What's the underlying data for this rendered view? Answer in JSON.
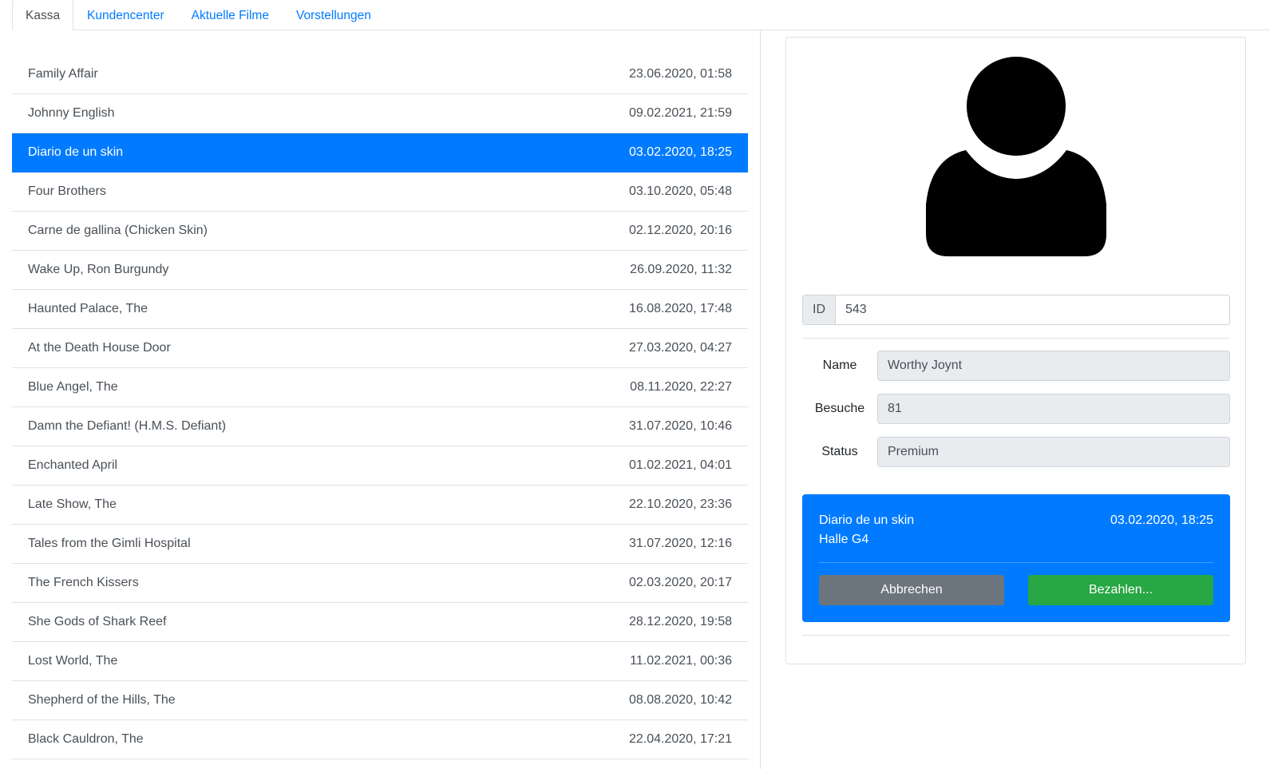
{
  "tabs": [
    {
      "label": "Kassa"
    },
    {
      "label": "Kundencenter"
    },
    {
      "label": "Aktuelle Filme"
    },
    {
      "label": "Vorstellungen"
    }
  ],
  "shows": [
    {
      "title": "Family Affair",
      "datetime": "23.06.2020, 01:58"
    },
    {
      "title": "Johnny English",
      "datetime": "09.02.2021, 21:59"
    },
    {
      "title": "Diario de un skin",
      "datetime": "03.02.2020, 18:25"
    },
    {
      "title": "Four Brothers",
      "datetime": "03.10.2020, 05:48"
    },
    {
      "title": "Carne de gallina (Chicken Skin)",
      "datetime": "02.12.2020, 20:16"
    },
    {
      "title": "Wake Up, Ron Burgundy",
      "datetime": "26.09.2020, 11:32"
    },
    {
      "title": "Haunted Palace, The",
      "datetime": "16.08.2020, 17:48"
    },
    {
      "title": "At the Death House Door",
      "datetime": "27.03.2020, 04:27"
    },
    {
      "title": "Blue Angel, The",
      "datetime": "08.11.2020, 22:27"
    },
    {
      "title": "Damn the Defiant! (H.M.S. Defiant)",
      "datetime": "31.07.2020, 10:46"
    },
    {
      "title": "Enchanted April",
      "datetime": "01.02.2021, 04:01"
    },
    {
      "title": "Late Show, The",
      "datetime": "22.10.2020, 23:36"
    },
    {
      "title": "Tales from the Gimli Hospital",
      "datetime": "31.07.2020, 12:16"
    },
    {
      "title": "The French Kissers",
      "datetime": "02.03.2020, 20:17"
    },
    {
      "title": "She Gods of Shark Reef",
      "datetime": "28.12.2020, 19:58"
    },
    {
      "title": "Lost World, The",
      "datetime": "11.02.2021, 00:36"
    },
    {
      "title": "Shepherd of the Hills, The",
      "datetime": "08.08.2020, 10:42"
    },
    {
      "title": "Black Cauldron, The",
      "datetime": "22.04.2020, 17:21"
    }
  ],
  "customer": {
    "avatar_icon": "user-silhouette-icon",
    "id_label": "ID",
    "id_value": "543",
    "name_label": "Name",
    "name_value": "Worthy Joynt",
    "visits_label": "Besuche",
    "visits_value": "81",
    "status_label": "Status",
    "status_value": "Premium"
  },
  "ticket": {
    "title": "Diario de un skin",
    "datetime": "03.02.2020, 18:25",
    "hall": "Halle G4",
    "cancel_label": "Abbrechen",
    "pay_label": "Bezahlen..."
  },
  "colors": {
    "primary": "#007bff",
    "success": "#28a745",
    "secondary": "#6c757d"
  }
}
